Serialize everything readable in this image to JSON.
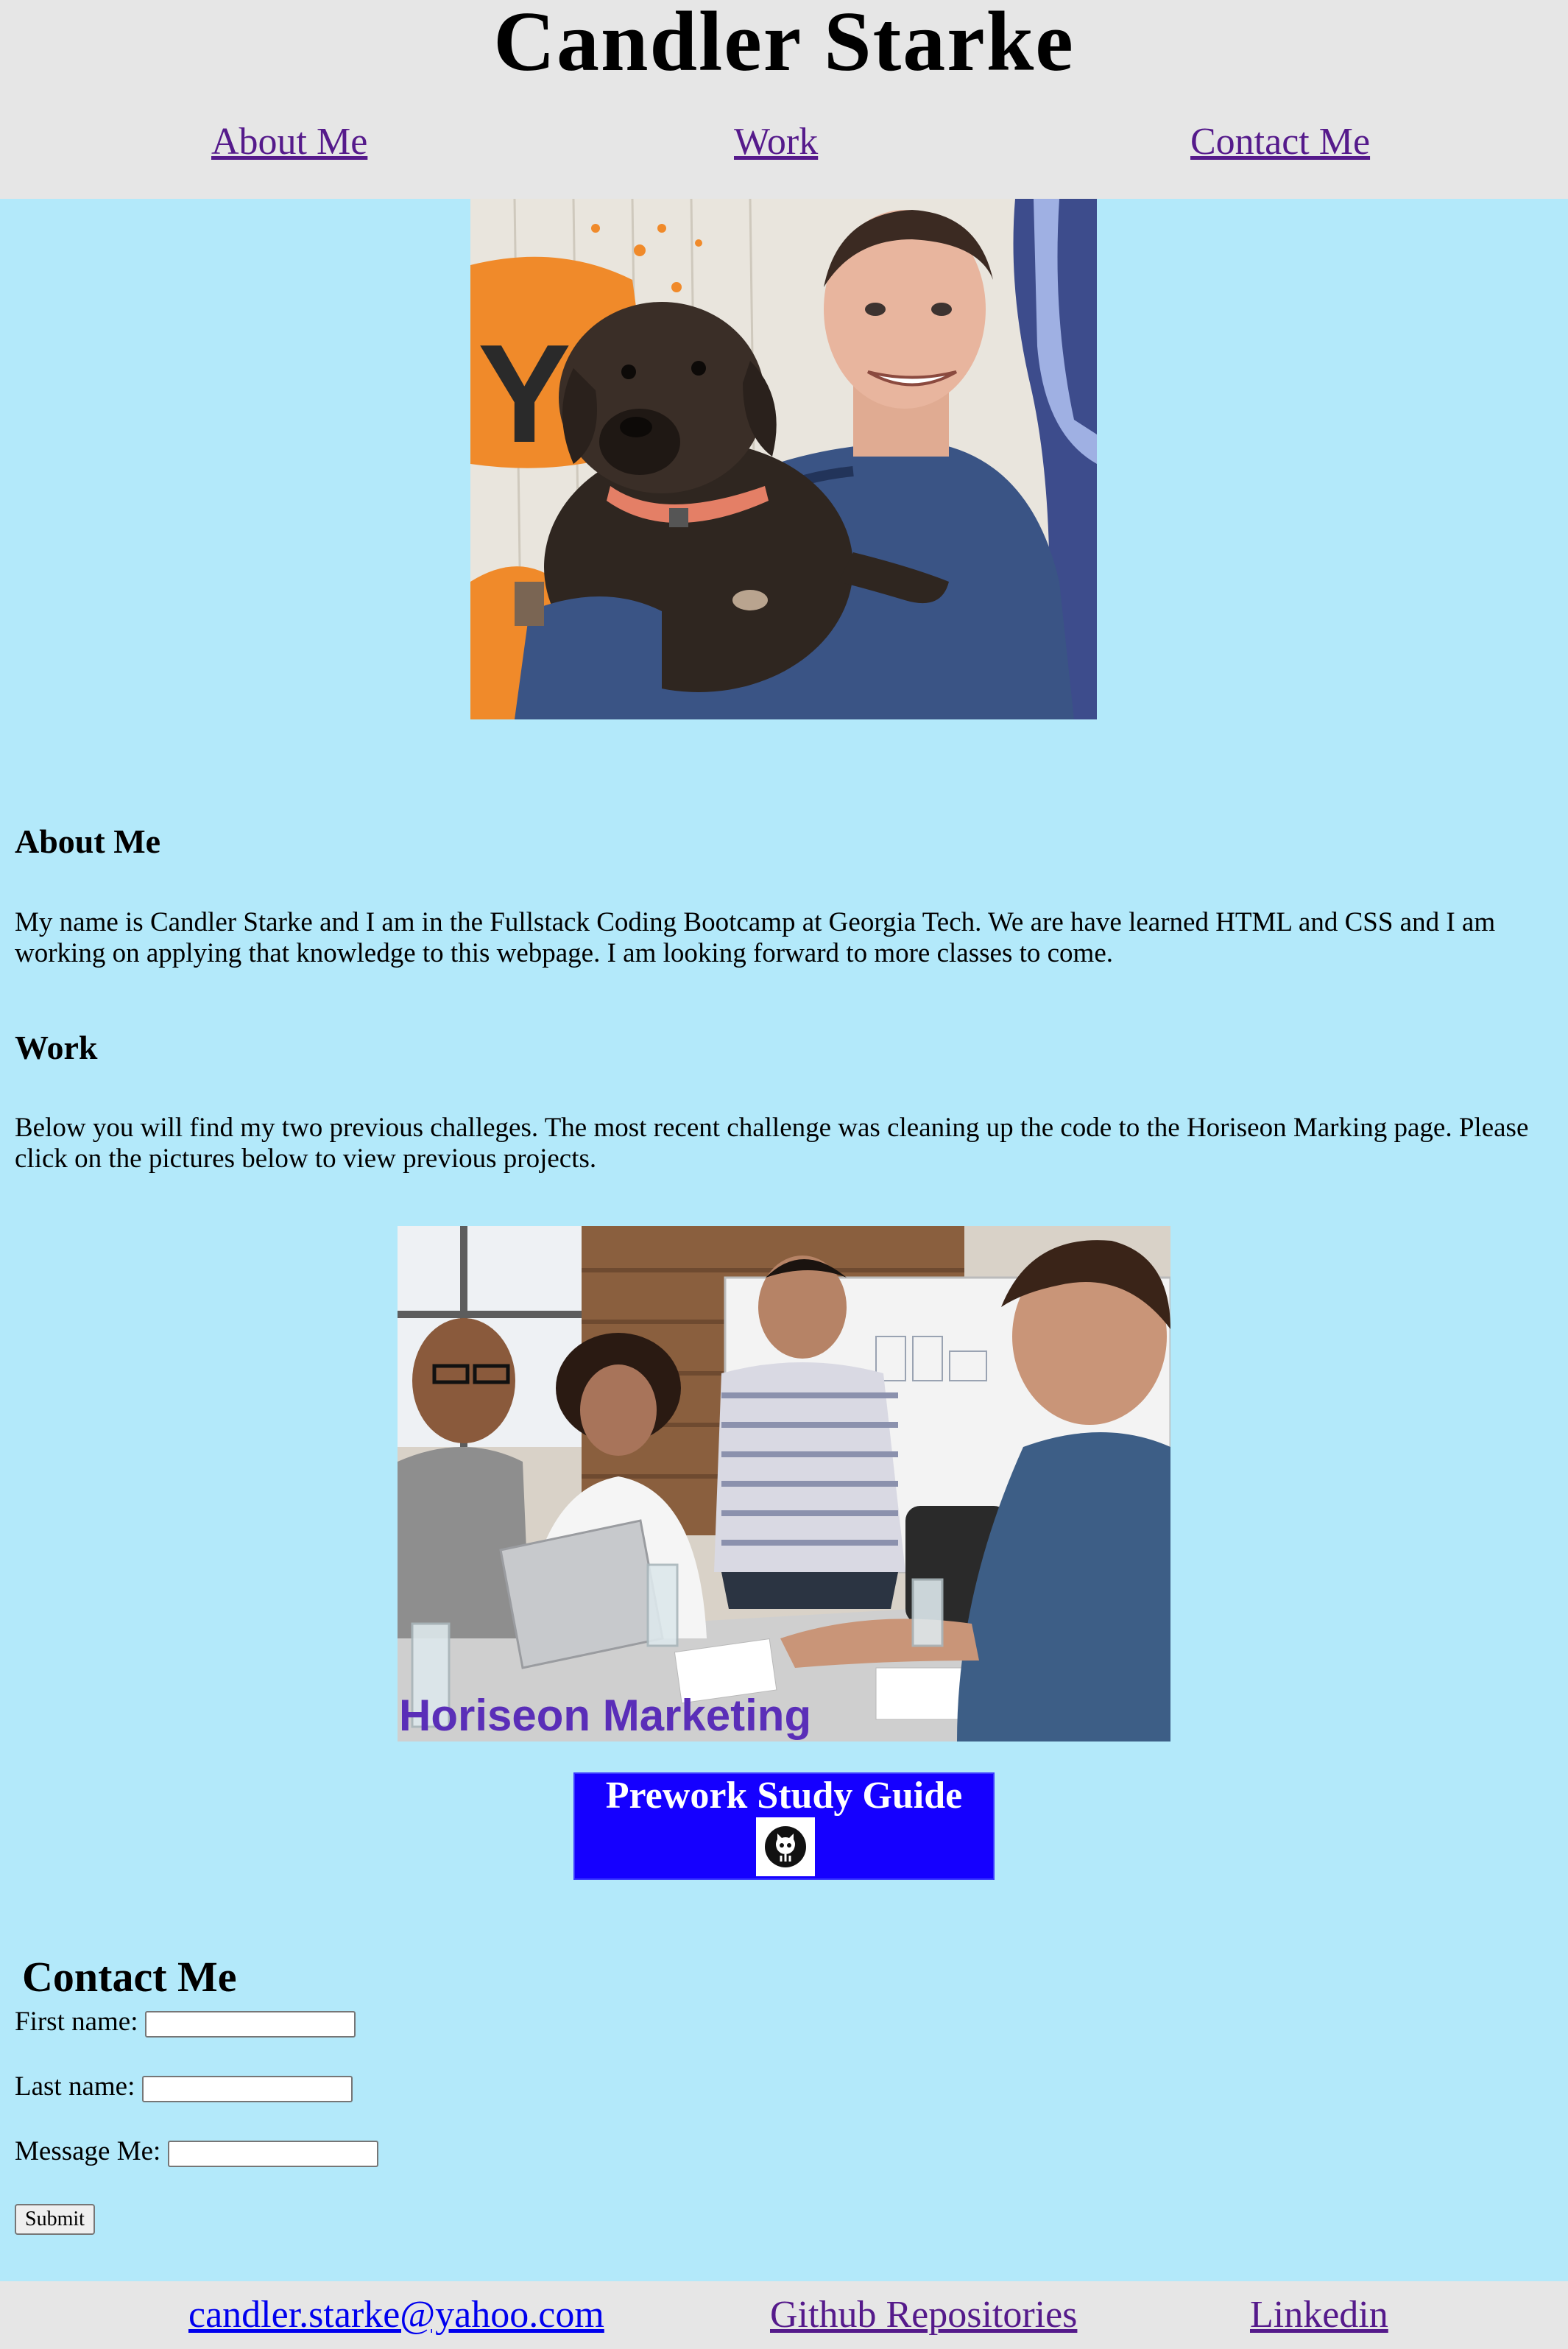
{
  "header": {
    "title": "Candler Starke",
    "nav": {
      "about": "About Me",
      "work": "Work",
      "contact": "Contact Me"
    }
  },
  "about": {
    "heading": "About Me",
    "text": "My name is Candler Starke and I am in the Fullstack Coding Bootcamp at Georgia Tech. We are have learned HTML and CSS and I am working on applying that knowledge to this webpage. I am looking forward to more classes to come."
  },
  "work": {
    "heading": "Work",
    "text": "Below you will find my two previous challeges. The most recent challenge was cleaning up the code to the Horiseon Marking page. Please click on the pictures below to view previous projects.",
    "projects": [
      {
        "caption": "Horiseon Marketing"
      },
      {
        "caption": "Prework Study Guide",
        "icon": "github-cat-icon"
      }
    ]
  },
  "contact": {
    "heading": "Contact Me",
    "first_name_label": "First name:",
    "last_name_label": "Last name:",
    "message_label": "Message Me:",
    "submit_label": "Submit"
  },
  "footer": {
    "email": "candler.starke@yahoo.com",
    "github": "Github Repositories",
    "linkedin": "Linkedin"
  },
  "colors": {
    "page_background": "#b3e9fa",
    "header_background": "#e6e6e6",
    "visited_link": "#551a8b",
    "link": "#0000ee",
    "prework_blue": "#1500ff"
  }
}
